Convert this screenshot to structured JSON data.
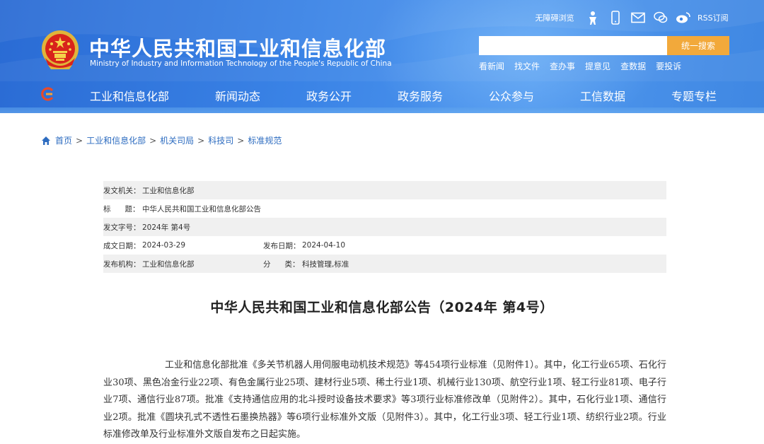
{
  "header": {
    "title": "中华人民共和国工业和信息化部",
    "subtitle": "Ministry of Industry and Information Technology of the People's Republic of China",
    "top_links": {
      "accessibility": "无障碍浏览",
      "rss": "RSS订阅",
      "icons": [
        "person-icon",
        "mobile-icon",
        "mail-icon",
        "wechat-icon",
        "weibo-icon",
        "rss-icon"
      ]
    },
    "search": {
      "placeholder": "",
      "button": "统一搜索"
    },
    "quick_links": [
      "看新闻",
      "找文件",
      "查办事",
      "提意见",
      "查数据",
      "要投诉"
    ],
    "nav": [
      "工业和信息化部",
      "新闻动态",
      "政务公开",
      "政务服务",
      "公众参与",
      "工信数据",
      "专题专栏"
    ],
    "colors": {
      "header_blue": "#3a83e6",
      "search_button": "#f2a93b",
      "emblem_red": "#d8231b"
    }
  },
  "breadcrumb": [
    "首页",
    "工业和信息化部",
    "机关司局",
    "科技司",
    "标准规范"
  ],
  "meta": {
    "issuer_label": "发文机关：",
    "issuer": "工业和信息化部",
    "title_label": "标      题：",
    "title": "中华人民共和国工业和信息化部公告",
    "doc_no_label": "发文字号：",
    "doc_no": "2024年 第4号",
    "created_label": "成文日期：",
    "created": "2024-03-29",
    "published_label": "发布日期：",
    "published": "2024-04-10",
    "org_label": "发布机构：",
    "org": "工业和信息化部",
    "category_label": "分      类：",
    "category": "科技管理,标准"
  },
  "document": {
    "heading": "中华人民共和国工业和信息化部公告（2024年 第4号）",
    "paragraph": "工业和信息化部批准《多关节机器人用伺服电动机技术规范》等454项行业标准（见附件1）。其中，化工行业65项、石化行业30项、黑色冶金行业22项、有色金属行业25项、建材行业5项、稀土行业1项、机械行业130项、航空行业1项、轻工行业81项、电子行业7项、通信行业87项。批准《支持通信应用的北斗授时设备技术要求》等3项行业标准修改单（见附件2）。其中，石化行业1项、通信行业2项。批准《圆块孔式不透性石墨换热器》等6项行业标准外文版（见附件3）。其中，化工行业3项、轻工行业1项、纺织行业2项。行业标准修改单及行业标准外文版自发布之日起实施。"
  }
}
